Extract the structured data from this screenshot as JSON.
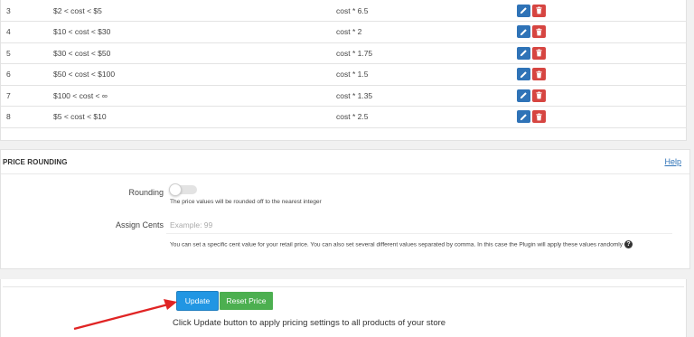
{
  "rules": [
    {
      "num": "3",
      "range": "$2 < cost < $5",
      "formula": "cost * 6.5"
    },
    {
      "num": "4",
      "range": "$10 < cost < $30",
      "formula": "cost * 2"
    },
    {
      "num": "5",
      "range": "$30 < cost < $50",
      "formula": "cost * 1.75"
    },
    {
      "num": "6",
      "range": "$50 < cost < $100",
      "formula": "cost * 1.5"
    },
    {
      "num": "7",
      "range": "$100 < cost < ∞",
      "formula": "cost * 1.35"
    },
    {
      "num": "8",
      "range": "$5 < cost < $10",
      "formula": "cost * 2.5"
    }
  ],
  "rounding": {
    "title": "PRICE ROUNDING",
    "help_link": "Help",
    "rounding_label": "Rounding",
    "rounding_on": false,
    "rounding_help": "The price values will be rounded off to the nearest integer",
    "cents_label": "Assign Cents",
    "cents_value": "",
    "cents_placeholder": "Example: 99",
    "cents_help": "You can set a specific cent value for your retail price. You can also set several different values separated by comma. In this case the Plugin will apply these values randomly"
  },
  "update": {
    "update_label": "Update",
    "reset_label": "Reset Price",
    "note": "Click Update button to apply pricing settings to all products of your store"
  },
  "colors": {
    "edit": "#2f73b7",
    "delete": "#d64541",
    "update": "#2196e3",
    "reset": "#4caf50",
    "arrow": "#e02424"
  }
}
